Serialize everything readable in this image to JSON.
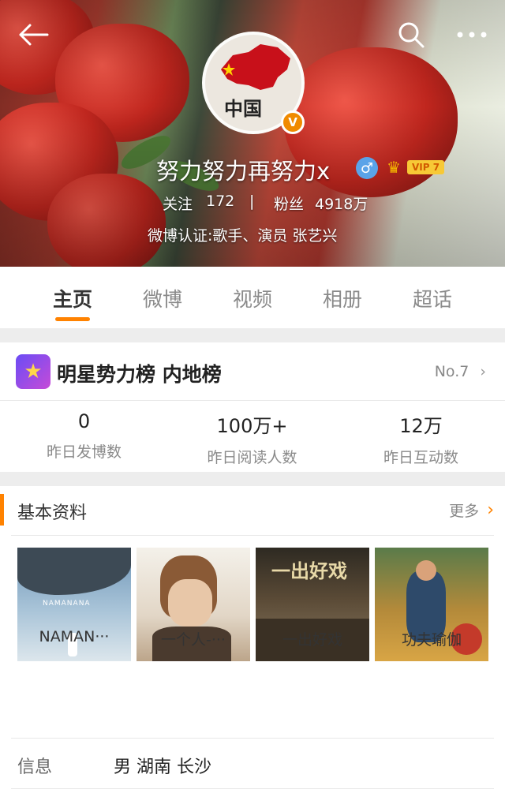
{
  "header": {
    "user_name": "努力努力再努力x",
    "gender_symbol": "♂",
    "vip_label": "VIP 7",
    "verified_badge": "V",
    "follow_label": "关注",
    "follow_count": "172",
    "separator": "|",
    "fans_label": "粉丝",
    "fans_count": "4918万",
    "verification": "微博认证:歌手、演员 张艺兴",
    "avatar_text": "中国"
  },
  "tabs": [
    {
      "label": "主页",
      "active": true
    },
    {
      "label": "微博",
      "active": false
    },
    {
      "label": "视频",
      "active": false
    },
    {
      "label": "相册",
      "active": false
    },
    {
      "label": "超话",
      "active": false
    }
  ],
  "ranking": {
    "title": "明星势力榜 内地榜",
    "rank": "No.7",
    "stats": [
      {
        "value": "0",
        "label": "昨日发博数"
      },
      {
        "value": "100万+",
        "label": "昨日阅读人数"
      },
      {
        "value": "12万",
        "label": "昨日互动数"
      }
    ]
  },
  "basic_info": {
    "title": "基本资料",
    "more": "更多",
    "works": [
      {
        "title": "NAMAN···",
        "cover_text": "NAMANANA"
      },
      {
        "title": "一个人-···",
        "cover_text": ""
      },
      {
        "title": "一出好戏",
        "cover_text": "一出好戏"
      },
      {
        "title": "功夫瑜伽",
        "cover_text": ""
      }
    ],
    "info_label": "信息",
    "info_value": "男 湖南 长沙"
  },
  "colors": {
    "accent": "#ff8200",
    "gender_blue": "#5aa3e8",
    "vip_gold": "#f7c936"
  }
}
